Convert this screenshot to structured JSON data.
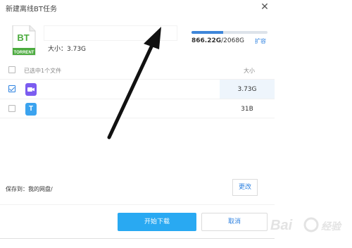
{
  "window": {
    "title": "新建离线BT任务"
  },
  "torrent": {
    "badge_text": "BT",
    "badge_caption": "TORRENT",
    "size_label": "大小：3.73G"
  },
  "quota": {
    "used": "866.22G",
    "total": "/2068G",
    "used_fraction": 0.419,
    "expand_label": "扩容",
    "fill_color": "#3e86d9"
  },
  "file_list": {
    "header_label": "已选中1个文件",
    "size_header": "大小",
    "rows": [
      {
        "icon": "video-file-icon",
        "checked": true,
        "size": "3.73G"
      },
      {
        "icon": "text-file-icon",
        "icon_letter": "T",
        "checked": false,
        "size": "31B"
      }
    ]
  },
  "save": {
    "label": "保存到：我的网盘/",
    "change_label": "更改"
  },
  "actions": {
    "start_label": "开始下载",
    "cancel_label": "取消"
  },
  "colors": {
    "primary": "#29a9f2",
    "link": "#2f82e0",
    "bt_green": "#4bab3e"
  }
}
